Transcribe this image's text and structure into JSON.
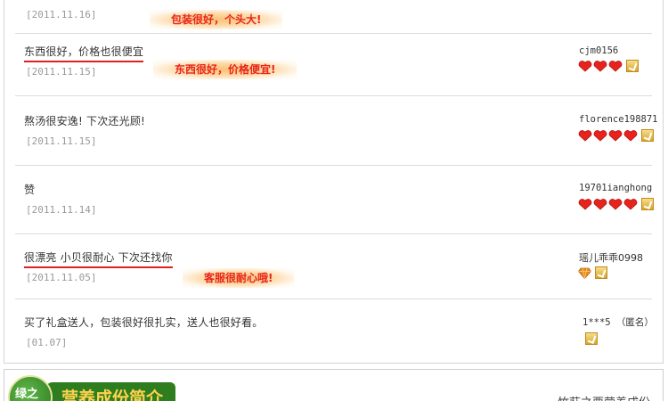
{
  "reviews": [
    {
      "text": "",
      "date": "[2011.11.16]",
      "user": "",
      "note": "包装很好，个头大!"
    },
    {
      "text": "东西很好，价格也很便宜",
      "date": "[2011.11.15]",
      "user": "cjm0156",
      "note": "东西很好，价格便宜!"
    },
    {
      "text": "熬汤很安逸! 下次还光顾!",
      "date": "[2011.11.15]",
      "user": "florence198871",
      "note": ""
    },
    {
      "text": "赞",
      "date": "[2011.11.14]",
      "user": "19701ianghong",
      "note": ""
    },
    {
      "text": "很漂亮 小贝很耐心 下次还找你",
      "date": "[2011.11.05]",
      "user": "瑶儿乖乖0998",
      "note": "客服很耐心哦!"
    },
    {
      "text": "买了礼盒送人，包装很好很扎实，送人也很好看。",
      "date": "[01.07]",
      "user": "1***5 （匿名）",
      "note": ""
    }
  ],
  "section": {
    "badge_text": "绿之",
    "title": "营养成份简介",
    "side_text": "竹荪之栗营养成份"
  },
  "colors": {
    "accent_red": "#e02020",
    "heart": "#e8231b",
    "green": "#2e7d1f",
    "title_yellow": "#ffd24d"
  }
}
